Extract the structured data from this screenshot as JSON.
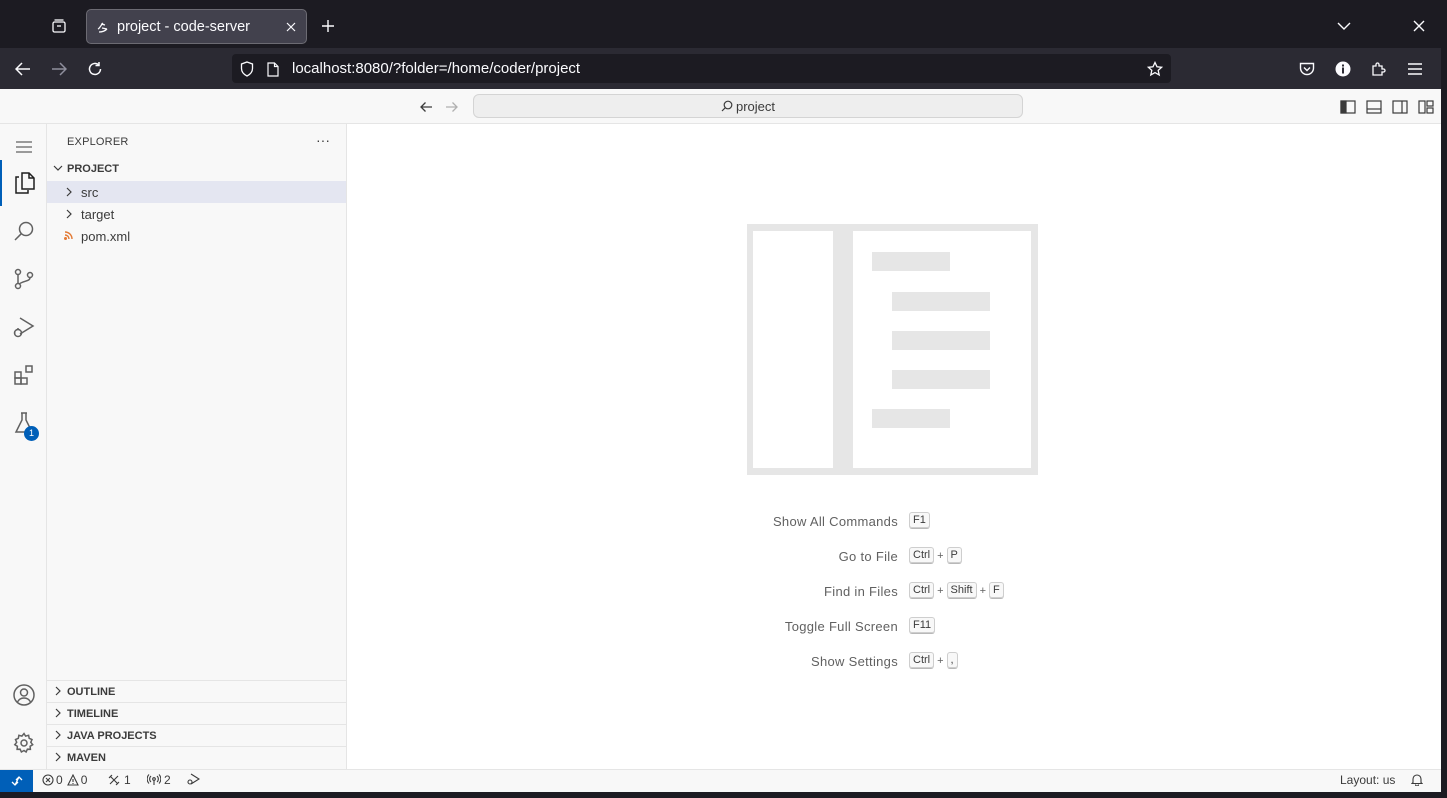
{
  "browser": {
    "tab_title": "project - code-server",
    "url": "localhost:8080/?folder=/home/coder/project"
  },
  "titlebar": {
    "command_center_label": "project"
  },
  "activitybar": {
    "test_badge": "1"
  },
  "sidebar": {
    "title": "EXPLORER",
    "more_label": "···",
    "project_section": "PROJECT",
    "tree": [
      {
        "label": "src",
        "type": "folder"
      },
      {
        "label": "target",
        "type": "folder"
      },
      {
        "label": "pom.xml",
        "type": "file"
      }
    ],
    "bottom_sections": [
      "OUTLINE",
      "TIMELINE",
      "JAVA PROJECTS",
      "MAVEN"
    ]
  },
  "editor": {
    "shortcuts": [
      {
        "label": "Show All Commands",
        "keys": [
          "F1"
        ]
      },
      {
        "label": "Go to File",
        "keys": [
          "Ctrl",
          "P"
        ]
      },
      {
        "label": "Find in Files",
        "keys": [
          "Ctrl",
          "Shift",
          "F"
        ]
      },
      {
        "label": "Toggle Full Screen",
        "keys": [
          "F11"
        ]
      },
      {
        "label": "Show Settings",
        "keys": [
          "Ctrl",
          ","
        ]
      }
    ]
  },
  "statusbar": {
    "errors": "0",
    "warnings": "0",
    "ports": "1",
    "broadcast": "2",
    "layout": "Layout: us"
  },
  "colors": {
    "accent": "#005fb8",
    "browser_dark": "#1c1b22",
    "toolbar": "#2b2a33"
  }
}
